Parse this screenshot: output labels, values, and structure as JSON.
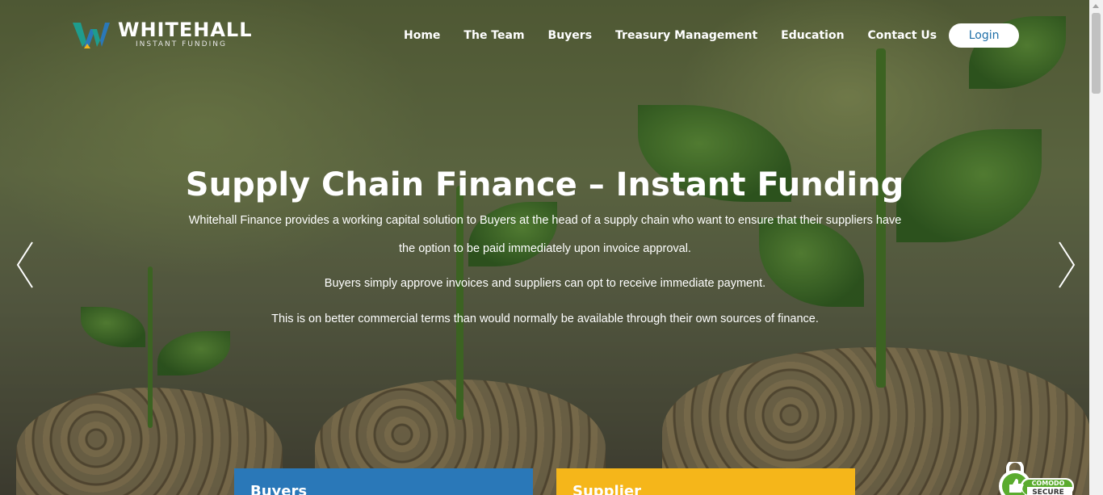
{
  "brand": {
    "name": "WHITEHALL",
    "tagline": "INSTANT FUNDING",
    "colors": {
      "teal": "#1f9c8d",
      "blue": "#2a78b8",
      "yellow": "#f2b51c"
    }
  },
  "nav": {
    "items": [
      "Home",
      "The Team",
      "Buyers",
      "Treasury Management",
      "Education",
      "Contact Us"
    ],
    "login_label": "Login"
  },
  "hero": {
    "title": "Supply Chain Finance – Instant Funding",
    "paragraph_1": "Whitehall Finance provides a working capital solution to Buyers at the head of a supply chain who want to ensure that their suppliers have the option to be paid immediately upon invoice approval.",
    "paragraph_2": "Buyers simply approve invoices and suppliers can opt to receive immediate payment.",
    "paragraph_3": "This is on better commercial terms than would normally be available through their own sources of finance.",
    "prev_icon": "chevron-left-icon",
    "next_icon": "chevron-right-icon"
  },
  "cards": [
    {
      "title": "Buyers",
      "color": "#2a78b8"
    },
    {
      "title": "Supplier",
      "color": "#f5b61a"
    }
  ],
  "badge": {
    "line1": "COMODO",
    "line2": "SECURE"
  }
}
